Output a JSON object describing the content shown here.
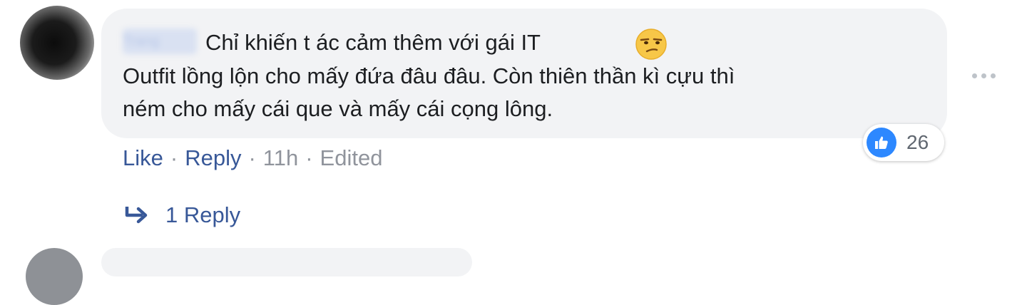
{
  "comment": {
    "author": "Trang",
    "lines": [
      "Chỉ khiến t ác cảm thêm với gái IT",
      "Outfit lồng lộn cho mấy đứa đâu đâu. Còn thiên thần kì cựu thì",
      "ném cho mấy cái que và mấy cái cọng lông."
    ],
    "emoji": "unamused-face-icon",
    "reaction_count": "26",
    "reaction_icon": "thumbs-up-icon",
    "actions": {
      "like": "Like",
      "reply": "Reply",
      "time": "11h",
      "edited": "Edited",
      "separator": "·"
    },
    "replies_label": "1 Reply"
  },
  "colors": {
    "bubble": "#f2f3f5",
    "text": "#1c1e21",
    "link": "#385898",
    "muted": "#90949c",
    "like_blue": "#2d88ff"
  }
}
